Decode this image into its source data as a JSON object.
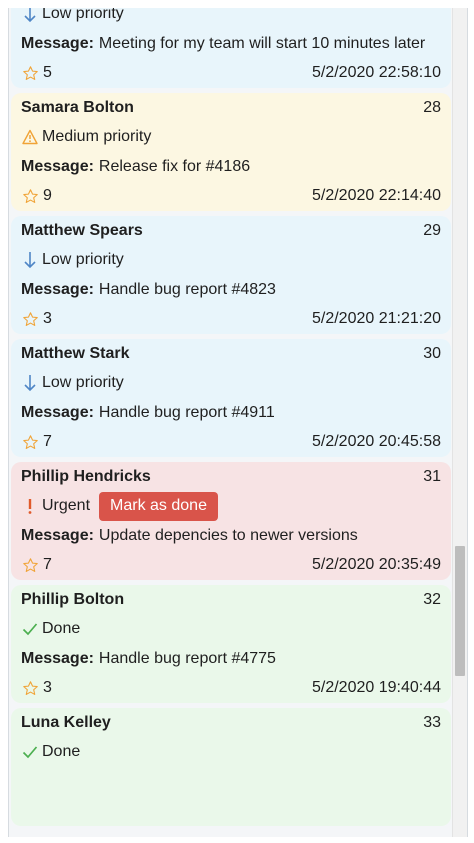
{
  "labels": {
    "message": "Message:",
    "mark_done": "Mark as done"
  },
  "colors": {
    "low_bg": "#e8f5fb",
    "medium_bg": "#fcf7e2",
    "urgent_bg": "#f7e3e4",
    "done_bg": "#eaf8ea",
    "button_red": "#d9544a",
    "star_orange": "#f0a336",
    "arrow_blue": "#4f86c6",
    "check_green": "#4caf50",
    "warning_orange": "#f0a336",
    "urgent_red": "#e05a2b"
  },
  "icons": {
    "low": "arrow-down-icon",
    "medium": "warning-triangle-icon",
    "urgent": "exclamation-icon",
    "done": "checkmark-icon",
    "star": "star-icon"
  },
  "tasks": [
    {
      "name": "",
      "number": "",
      "priority_label": "Low priority",
      "message": "Meeting for my team will start 10 minutes later",
      "stars": "5",
      "timestamp": "5/2/2020 22:58:10"
    },
    {
      "name": "Samara Bolton",
      "number": "28",
      "priority_label": "Medium priority",
      "message": "Release fix for #4186",
      "stars": "9",
      "timestamp": "5/2/2020 22:14:40"
    },
    {
      "name": "Matthew Spears",
      "number": "29",
      "priority_label": "Low priority",
      "message": "Handle bug report #4823",
      "stars": "3",
      "timestamp": "5/2/2020 21:21:20"
    },
    {
      "name": "Matthew Stark",
      "number": "30",
      "priority_label": "Low priority",
      "message": "Handle bug report #4911",
      "stars": "7",
      "timestamp": "5/2/2020 20:45:58"
    },
    {
      "name": "Phillip Hendricks",
      "number": "31",
      "priority_label": "Urgent",
      "message": "Update depencies to newer versions",
      "stars": "7",
      "timestamp": "5/2/2020 20:35:49"
    },
    {
      "name": "Phillip Bolton",
      "number": "32",
      "priority_label": "Done",
      "message": "Handle bug report #4775",
      "stars": "3",
      "timestamp": "5/2/2020 19:40:44"
    },
    {
      "name": "Luna Kelley",
      "number": "33",
      "priority_label": "Done",
      "message": "",
      "stars": "",
      "timestamp": ""
    }
  ]
}
